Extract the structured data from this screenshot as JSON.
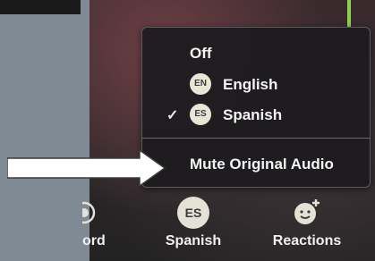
{
  "menu": {
    "items": [
      {
        "label": "Off",
        "badge": "",
        "checked": false
      },
      {
        "label": "English",
        "badge": "EN",
        "checked": false
      },
      {
        "label": "Spanish",
        "badge": "ES",
        "checked": true
      }
    ],
    "check_glyph": "✓",
    "mute_label": "Mute Original Audio"
  },
  "toolbar": {
    "record_partial": "ord",
    "language_badge": "ES",
    "language_label": "Spanish",
    "reactions_label": "Reactions"
  },
  "icons": {
    "record": "record-icon",
    "interpretation": "interpretation-language-icon",
    "reactions": "reactions-icon",
    "arrow": "pointer-arrow-icon"
  },
  "colors": {
    "menu_bg": "#1c1b1e",
    "badge_bg": "#e9e6d8",
    "arrow_fill": "#ffffff",
    "indicator": "#8fd14f"
  }
}
